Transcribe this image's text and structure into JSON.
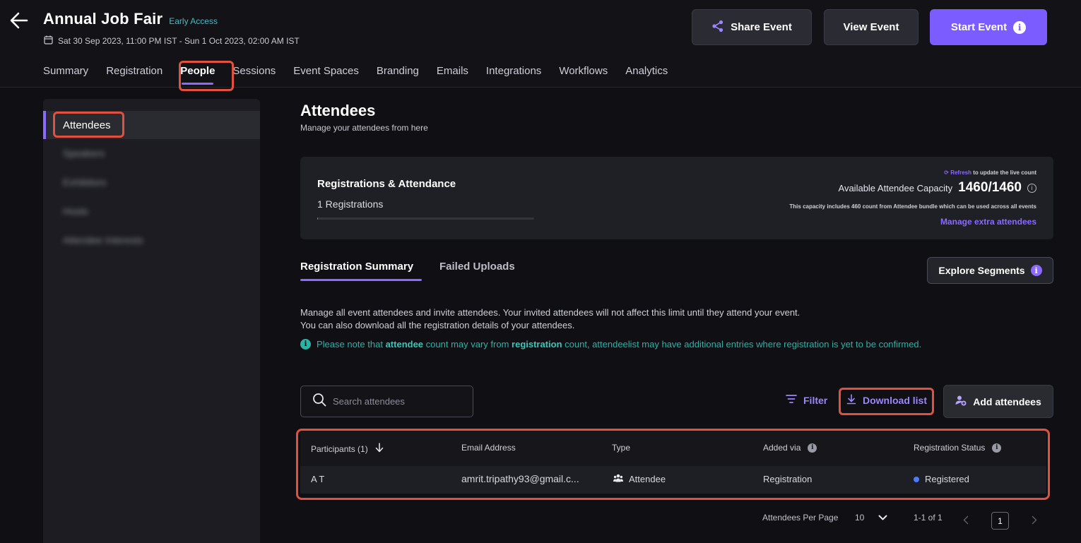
{
  "header": {
    "title": "Annual Job Fair",
    "badge": "Early Access",
    "date_range": "Sat 30 Sep 2023, 11:00 PM IST - Sun 1 Oct 2023, 02:00 AM IST",
    "buttons": {
      "share": "Share Event",
      "view": "View Event",
      "start": "Start Event"
    },
    "accent_color": "#7b5cff"
  },
  "nav": {
    "tabs": [
      "Summary",
      "Registration",
      "People",
      "Sessions",
      "Event Spaces",
      "Branding",
      "Emails",
      "Integrations",
      "Workflows",
      "Analytics"
    ],
    "active": "People"
  },
  "sidebar": {
    "items": [
      {
        "label": "Attendees",
        "active": true
      },
      {
        "label": "Speakers",
        "blurred": true
      },
      {
        "label": "Exhibitors",
        "blurred": true
      },
      {
        "label": "Hosts",
        "blurred": true
      },
      {
        "label": "Attendee Interests",
        "blurred": true
      }
    ]
  },
  "main": {
    "title": "Attendees",
    "subtitle": "Manage your attendees from here",
    "registration_card": {
      "title": "Registrations & Attendance",
      "count": "1 Registrations",
      "refresh_link": "Refresh",
      "refresh_text": "to update the live count",
      "capacity_label": "Available Attendee Capacity",
      "capacity_value": "1460/1460",
      "capacity_note": "This capacity includes 460 count from Attendee bundle which can be used across all events",
      "manage_link": "Manage extra attendees"
    },
    "tabs": [
      "Registration Summary",
      "Failed Uploads"
    ],
    "explore_button": "Explore Segments",
    "description_line1": "Manage all event attendees and invite attendees. Your invited attendees will not affect this limit until they attend your event.",
    "description_line2": "You can also download all the registration details of your attendees.",
    "note": {
      "p1": "Please note that ",
      "b1": "attendee",
      "p2": " count may vary from ",
      "b2": "registration",
      "p3": " count, attendeelist may have additional entries where registration is yet to be confirmed."
    },
    "search": {
      "placeholder": "Search attendees",
      "value": ""
    },
    "filter_label": "Filter",
    "download_label": "Download list",
    "add_label": "Add attendees",
    "table": {
      "columns": [
        "Participants (1)",
        "Email Address",
        "Type",
        "Added via",
        "Registration Status"
      ],
      "rows": [
        {
          "name": "A T",
          "email": "amrit.tripathy93@gmail.c...",
          "type": "Attendee",
          "added_via": "Registration",
          "status": "Registered"
        }
      ]
    },
    "pagination": {
      "per_page_label": "Attendees Per Page",
      "per_page_value": "10",
      "range": "1-1 of 1",
      "current_page": "1"
    }
  }
}
